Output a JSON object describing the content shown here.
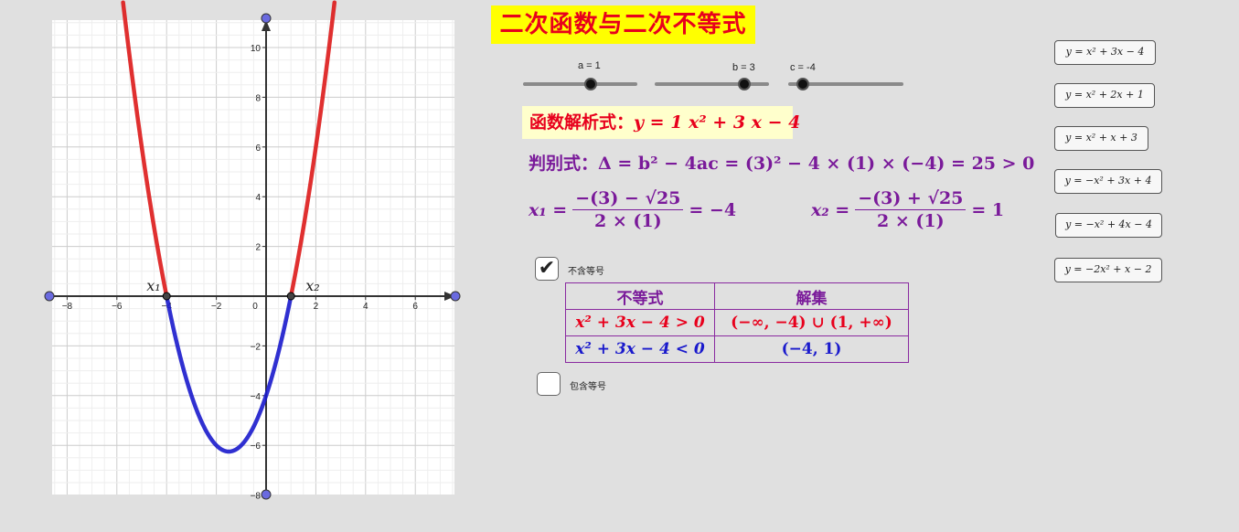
{
  "title": "二次函数与二次不等式",
  "sliders": [
    {
      "label": "a = 1",
      "value": 1
    },
    {
      "label": "b = 3",
      "value": 3
    },
    {
      "label": "c = -4",
      "value": -4
    }
  ],
  "formula": {
    "prefix": "函数解析式：",
    "expr": "y = 1 x² + 3 x − 4"
  },
  "discriminant": {
    "prefix": "判别式：",
    "expr": "Δ = b² − 4ac = (3)² − 4 × (1) × (−4) = 25 > 0"
  },
  "roots": {
    "x1_lhs": "x₁ =",
    "x1_num": "−(3) − √25",
    "x1_den": "2 × (1)",
    "x1_val": "= −4",
    "x2_lhs": "x₂ =",
    "x2_num": "−(3) + √25",
    "x2_den": "2 × (1)",
    "x2_val": "= 1"
  },
  "checkbox_exclusive": {
    "label": "不含等号",
    "checked": true,
    "mark": "✔"
  },
  "checkbox_inclusive": {
    "label": "包含等号",
    "checked": false
  },
  "table": {
    "headers": [
      "不等式",
      "解集"
    ],
    "rows": [
      {
        "ineq": "x² + 3x − 4 > 0",
        "solution": "(−∞, −4) ∪ (1, +∞)"
      },
      {
        "ineq": "x² + 3x − 4 < 0",
        "solution": "(−4, 1)"
      }
    ]
  },
  "preset_buttons": [
    "y = x² + 3x − 4",
    "y = x² + 2x + 1",
    "y = x² + x + 3",
    "y = −x² + 3x + 4",
    "y = −x² + 4x − 4",
    "y = −2x² + x − 2"
  ],
  "graph": {
    "x_ticks": [
      "−8",
      "−6",
      "−4",
      "−2",
      "0",
      "2",
      "4",
      "6"
    ],
    "x_tick_values": [
      -8,
      -6,
      -4,
      -2,
      0,
      2,
      4,
      6
    ],
    "y_ticks": [
      "10",
      "8",
      "6",
      "4",
      "2",
      "−2",
      "−4",
      "−6",
      "−8"
    ],
    "y_tick_values": [
      10,
      8,
      6,
      4,
      2,
      -2,
      -4,
      -6,
      -8
    ],
    "root_labels": [
      "x₁",
      "x₂"
    ],
    "roots": [
      -4,
      1
    ],
    "coefficients": {
      "a": 1,
      "b": 3,
      "c": -4
    },
    "x_range": [
      -8.6,
      7.5
    ],
    "y_range": [
      -8,
      11.1
    ],
    "colors": {
      "positive": "#dd1a1a",
      "negative": "#1a1acc",
      "axis": "#333333",
      "grid_major": "#cccccc",
      "grid_minor": "#eeeeee",
      "point": "#6a6ae0"
    }
  }
}
